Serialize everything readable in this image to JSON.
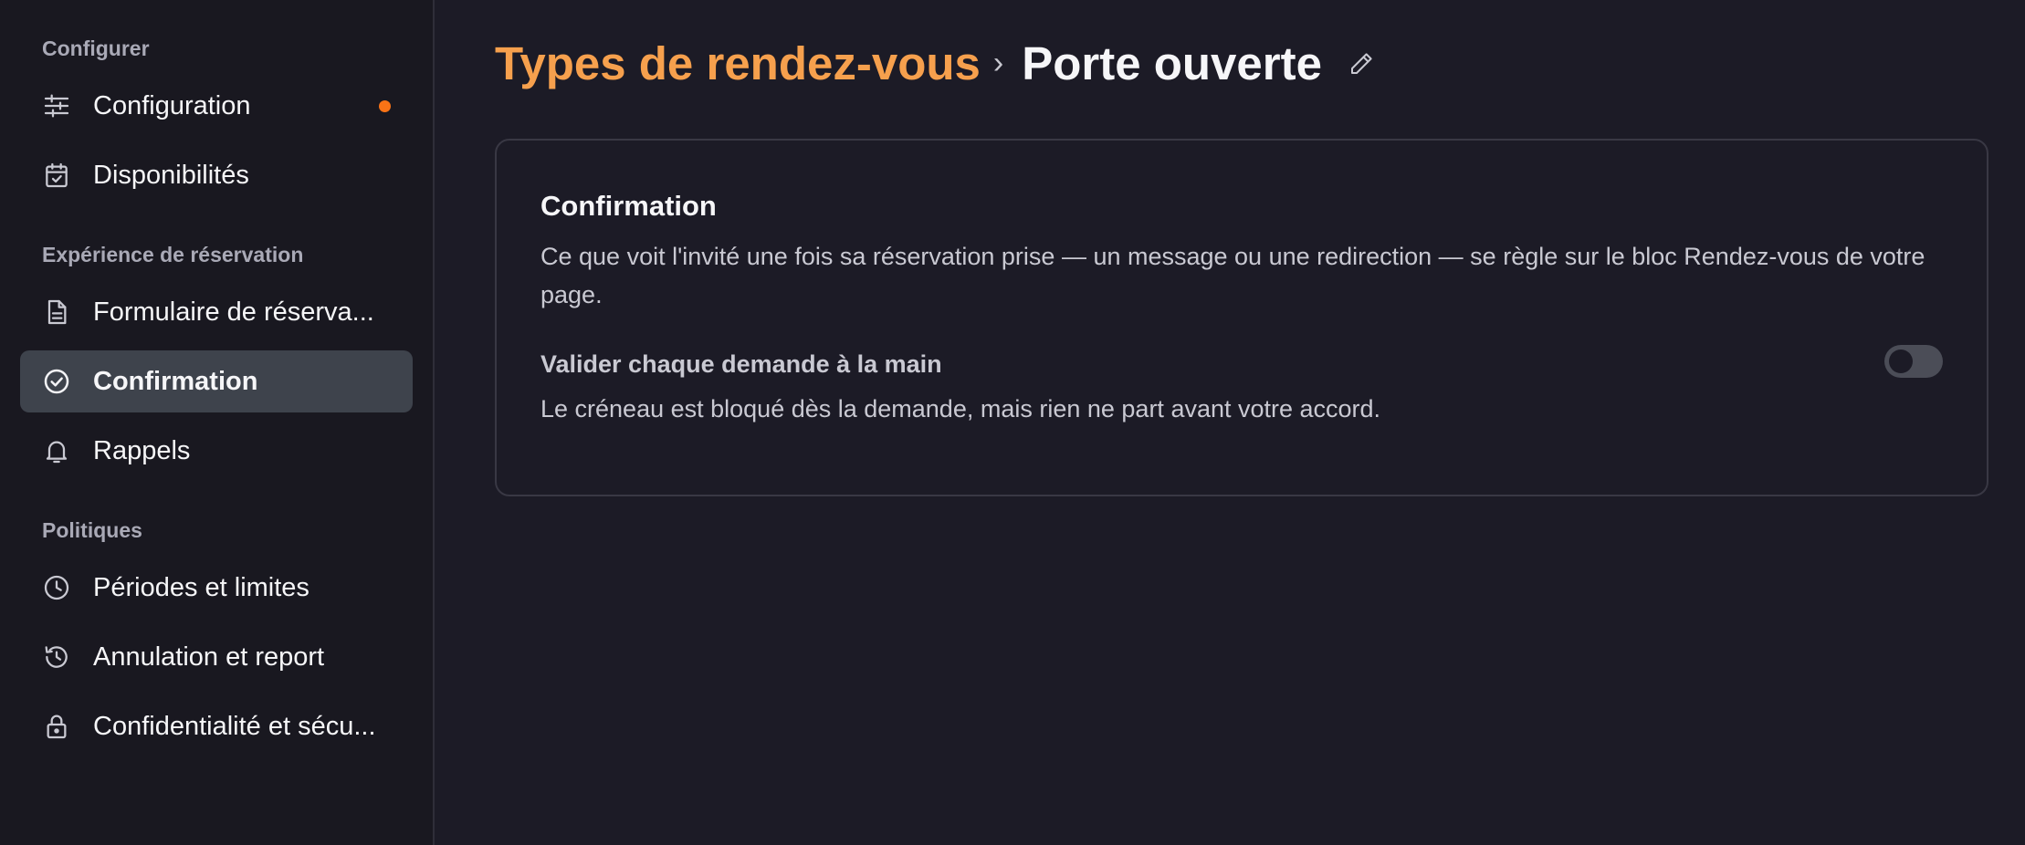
{
  "sidebar": {
    "sections": [
      {
        "title": "Configurer"
      },
      {
        "title": "Expérience de réservation"
      },
      {
        "title": "Politiques"
      }
    ],
    "items": [
      {
        "label": "Configuration",
        "icon": "sliders-icon"
      },
      {
        "label": "Disponibilités",
        "icon": "calendar-check-icon"
      },
      {
        "label": "Formulaire de réserva...",
        "icon": "document-icon"
      },
      {
        "label": "Confirmation",
        "icon": "check-circle-icon",
        "active": true
      },
      {
        "label": "Rappels",
        "icon": "bell-icon"
      },
      {
        "label": "Périodes et limites",
        "icon": "clock-icon"
      },
      {
        "label": "Annulation et report",
        "icon": "history-icon"
      },
      {
        "label": "Confidentialité et sécu...",
        "icon": "lock-icon"
      }
    ],
    "notification_color": "#f97316"
  },
  "header": {
    "breadcrumb_parent": "Types de rendez-vous",
    "separator": "›",
    "title": "Porte ouverte"
  },
  "card": {
    "title": "Confirmation",
    "description": "Ce que voit l'invité une fois sa réservation prise — un message ou une redirection — se règle sur le bloc Rendez-vous de votre page.",
    "setting": {
      "title": "Valider chaque demande à la main",
      "description": "Le créneau est bloqué dès la demande, mais rien ne part avant votre accord.",
      "enabled": false
    }
  },
  "colors": {
    "accent": "#f6a04d",
    "active_bg": "#3e434c",
    "background": "#1c1b26"
  }
}
